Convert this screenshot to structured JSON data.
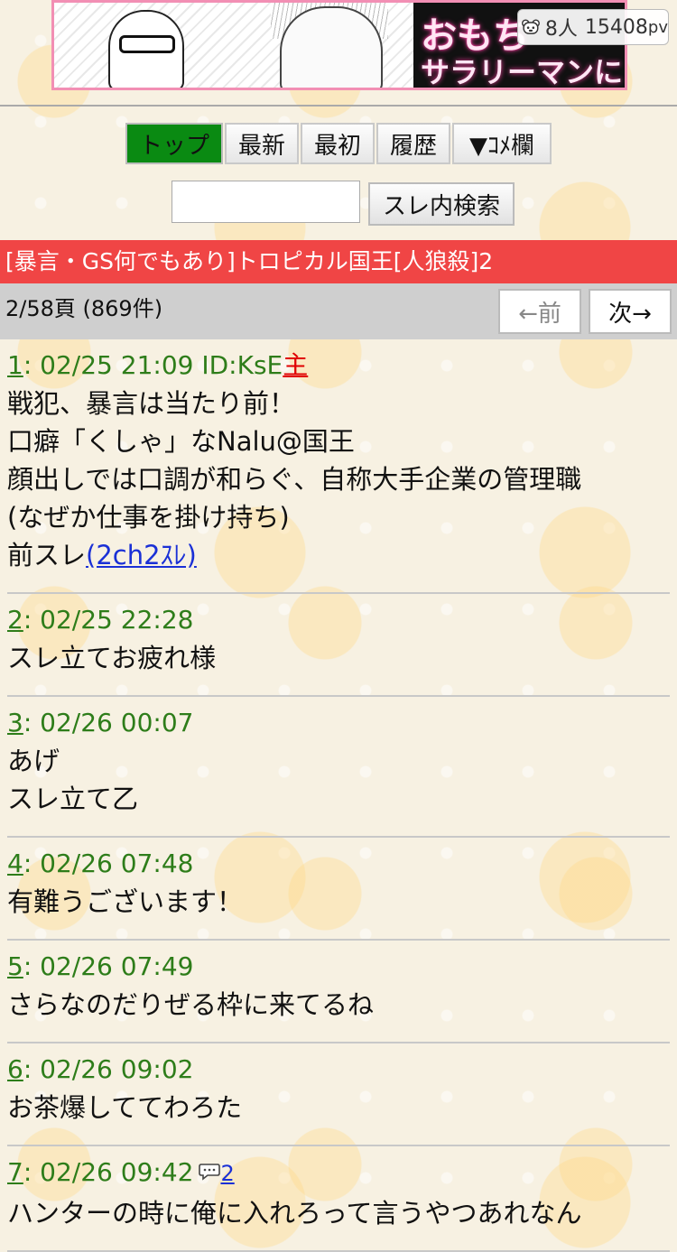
{
  "ad": {
    "line1": "おもち",
    "line2": "サラリーマンに"
  },
  "stats": {
    "users": "8人",
    "pv_count": "15408",
    "pv_unit": "pv"
  },
  "nav": {
    "top": "トップ",
    "latest": "最新",
    "first": "最初",
    "history": "履歴",
    "comment": "▼ｺﾒ欄"
  },
  "search": {
    "button": "スレ内検索",
    "value": ""
  },
  "thread": {
    "title": "[暴言・GS何でもあり]トロピカル国王[人狼殺]2"
  },
  "pager": {
    "info": "2/58頁 (869件)",
    "prev": "←前",
    "next": "次→"
  },
  "posts": [
    {
      "num": "1",
      "meta": ": 02/25 21:09 ID:KsE",
      "owner": "主",
      "lines": [
        "戦犯、暴言は当たり前！",
        "口癖「くしゃ」なNalu@国王",
        "顔出しでは口調が和らぐ、自称大手企業の管理職",
        "(なぜか仕事を掛け持ち)"
      ],
      "link_prefix": "前スレ",
      "link_text": "(2ch2ｽﾚ)"
    },
    {
      "num": "2",
      "meta": ": 02/25 22:28",
      "lines": [
        "スレ立てお疲れ様"
      ]
    },
    {
      "num": "3",
      "meta": ": 02/26 00:07",
      "lines": [
        "あげ",
        "スレ立て乙"
      ]
    },
    {
      "num": "4",
      "meta": ": 02/26 07:48",
      "lines": [
        "有難うございます！"
      ]
    },
    {
      "num": "5",
      "meta": ": 02/26 07:49",
      "lines": [
        "さらなのだりぜる枠に来てるね"
      ]
    },
    {
      "num": "6",
      "meta": ": 02/26 09:02",
      "lines": [
        "お茶爆しててわろた"
      ]
    },
    {
      "num": "7",
      "meta": ": 02/26 09:42",
      "reply_icon": "speech-bubble-icon",
      "reply_count": "2",
      "lines": [
        "ハンターの時に俺に入れろって言うやつあれなん"
      ]
    }
  ]
}
